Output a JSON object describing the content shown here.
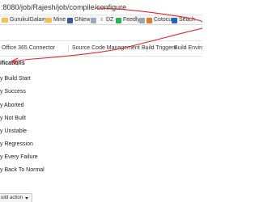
{
  "browser": {
    "url": ":8080/job/Rajesh/job/compile/configure",
    "bookmarks": [
      {
        "label": "GurukulGalaxy",
        "icon": "folder-icon"
      },
      {
        "label": "Mine",
        "icon": "folder-icon"
      },
      {
        "label": "GNew",
        "icon": "gnews-icon"
      },
      {
        "label": "DZ",
        "icon": "dzone-icon"
      },
      {
        "label": "Feedly",
        "icon": "feedly-icon"
      },
      {
        "label": "Cotocus",
        "icon": "cotocus-icon"
      },
      {
        "label": "Seach",
        "icon": "search-bookmark-icon"
      }
    ]
  },
  "tabs": [
    {
      "label": "Office 365 Connector"
    },
    {
      "label": "Source Code Management"
    },
    {
      "label": "Build Triggers"
    },
    {
      "label": "Build Environ"
    }
  ],
  "triggers": {
    "title": "ifications",
    "items": [
      {
        "label": "y Build Start"
      },
      {
        "label": "y Success"
      },
      {
        "label": "y Aborted"
      },
      {
        "label": "y Not Built"
      },
      {
        "label": "y Unstable"
      },
      {
        "label": "y Regression"
      },
      {
        "label": "y Every Failure"
      },
      {
        "label": "y Back To Normal"
      }
    ]
  },
  "footer": {
    "add_action_label": "uild action"
  },
  "colors": {
    "annotation": "#e3242b"
  }
}
